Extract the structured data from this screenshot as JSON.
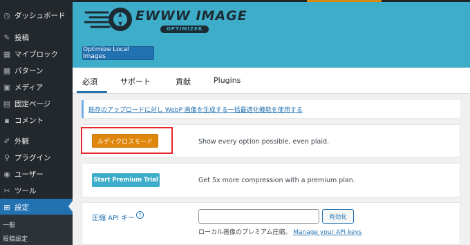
{
  "sidebar": {
    "items": [
      {
        "icon": "dashboard-icon",
        "glyph": "◷",
        "label": "ダッシュボード"
      },
      {
        "icon": "pin-icon",
        "glyph": "✎",
        "label": "投稿"
      },
      {
        "icon": "blocks-icon",
        "glyph": "▦",
        "label": "マイブロック"
      },
      {
        "icon": "patterns-icon",
        "glyph": "▦",
        "label": "パターン"
      },
      {
        "icon": "media-icon",
        "glyph": "▣",
        "label": "メディア"
      },
      {
        "icon": "page-icon",
        "glyph": "▤",
        "label": "固定ページ"
      },
      {
        "icon": "comment-icon",
        "glyph": "▪",
        "label": "コメント"
      },
      {
        "icon": "appearance-icon",
        "glyph": "✐",
        "label": "外観"
      },
      {
        "icon": "plugin-icon",
        "glyph": "⚲",
        "label": "プラグイン"
      },
      {
        "icon": "users-icon",
        "glyph": "◉",
        "label": "ユーザー"
      },
      {
        "icon": "tools-icon",
        "glyph": "✂",
        "label": "ツール"
      },
      {
        "icon": "settings-icon",
        "glyph": "⊞",
        "label": "設定"
      }
    ],
    "submenu": [
      "一般",
      "投稿設定"
    ]
  },
  "header": {
    "logo_main": "EWWW IMAGE",
    "logo_sub": "OPTIMIZER",
    "optimize_button": "Optimize Local Images"
  },
  "tabs": [
    "必須",
    "サポート",
    "貢献",
    "Plugins"
  ],
  "notice": {
    "link_text": "既存のアップロードに対し WebP 画像を生成する一括最適化機能を使用する"
  },
  "ludicrous": {
    "button": "ルディクロスモード",
    "text": "Show every option possible, even plaid."
  },
  "premium": {
    "button": "Start Premium Trial",
    "text": "Get 5x more compression with a premium plan."
  },
  "api": {
    "label": "圧縮 API キー",
    "help_glyph": "?",
    "input_value": "",
    "enable_button": "有効化",
    "description": "ローカル画像のプレミアム圧縮。",
    "manage_link": "Manage your API keys"
  },
  "colors": {
    "sidebar_bg": "#23282d",
    "accent": "#2271b1",
    "header_bg": "#3eadc9",
    "ludicrous_orange": "#e0860a",
    "highlight_red": "#e8262b"
  }
}
